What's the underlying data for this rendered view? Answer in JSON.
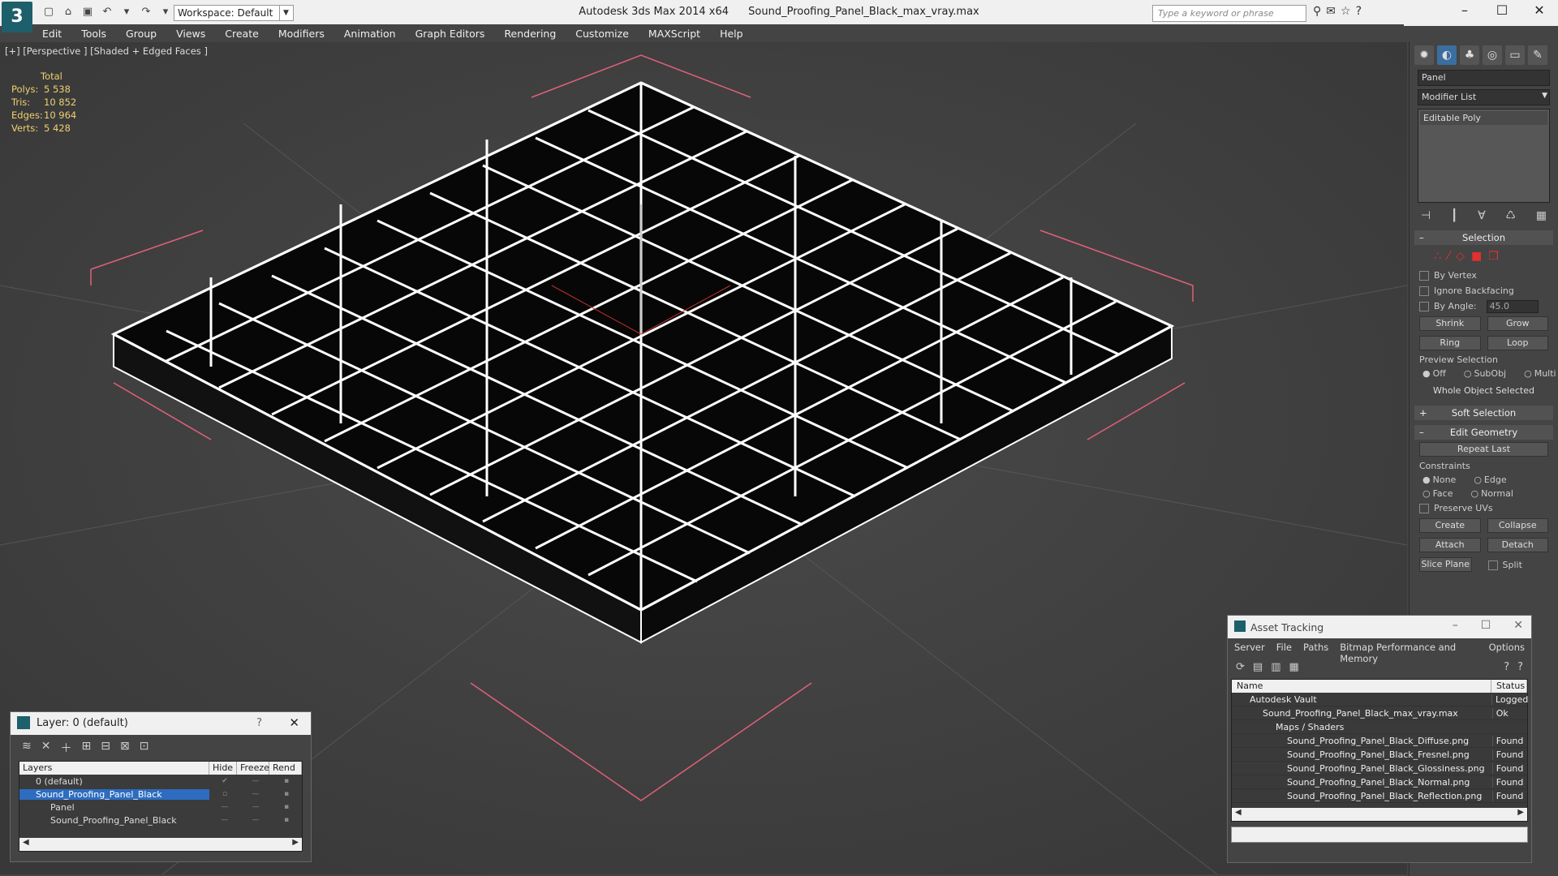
{
  "window": {
    "app_title": "Autodesk 3ds Max  2014 x64",
    "file_title": "Sound_Proofing_Panel_Black_max_vray.max",
    "workspace": "Workspace: Default",
    "search_placeholder": "Type a keyword or phrase"
  },
  "menu": [
    "Edit",
    "Tools",
    "Group",
    "Views",
    "Create",
    "Modifiers",
    "Animation",
    "Graph Editors",
    "Rendering",
    "Customize",
    "MAXScript",
    "Help"
  ],
  "viewport": {
    "label": "[+] [Perspective ] [Shaded + Edged Faces ]",
    "stats": {
      "header": "Total",
      "polys_label": "Polys:",
      "polys": "5 538",
      "tris_label": "Tris:",
      "tris": "10 852",
      "edges_label": "Edges:",
      "edges": "10 964",
      "verts_label": "Verts:",
      "verts": "5 428"
    }
  },
  "command_panel": {
    "object_name": "Panel",
    "modifier_list": "Modifier List",
    "stack_item": "Editable Poly",
    "selection": {
      "title": "Selection",
      "by_vertex": "By Vertex",
      "ignore_backfacing": "Ignore Backfacing",
      "by_angle": "By Angle:",
      "angle_value": "45.0",
      "shrink": "Shrink",
      "grow": "Grow",
      "ring": "Ring",
      "loop": "Loop",
      "preview_label": "Preview Selection",
      "preview_off": "Off",
      "preview_subobj": "SubObj",
      "preview_multi": "Multi",
      "status": "Whole Object Selected"
    },
    "soft_selection": "Soft Selection",
    "edit_geometry": {
      "title": "Edit Geometry",
      "repeat_last": "Repeat Last",
      "constraints": "Constraints",
      "none": "None",
      "edge": "Edge",
      "face": "Face",
      "normal": "Normal",
      "preserve_uvs": "Preserve UVs",
      "create": "Create",
      "collapse": "Collapse",
      "attach": "Attach",
      "detach": "Detach",
      "slice_plane": "Slice Plane",
      "split": "Split"
    }
  },
  "layer_window": {
    "title": "Layer: 0 (default)",
    "help": "?",
    "columns": [
      "Layers",
      "Hide",
      "Freeze",
      "Rend"
    ],
    "rows": [
      {
        "name": "0 (default)",
        "selected": false
      },
      {
        "name": "Sound_Proofing_Panel_Black",
        "selected": true
      },
      {
        "name": "Panel",
        "selected": false
      },
      {
        "name": "Sound_Proofing_Panel_Black",
        "selected": false
      }
    ]
  },
  "asset_tracking": {
    "title": "Asset Tracking",
    "menu": [
      "Server",
      "File",
      "Paths",
      "Bitmap Performance and Memory",
      "Options"
    ],
    "columns": [
      "Name",
      "Status"
    ],
    "rows": [
      {
        "name": "Autodesk Vault",
        "status": "Logged"
      },
      {
        "name": "Sound_Proofing_Panel_Black_max_vray.max",
        "status": "Ok"
      },
      {
        "name": "Maps / Shaders",
        "status": ""
      },
      {
        "name": "Sound_Proofing_Panel_Black_Diffuse.png",
        "status": "Found"
      },
      {
        "name": "Sound_Proofing_Panel_Black_Fresnel.png",
        "status": "Found"
      },
      {
        "name": "Sound_Proofing_Panel_Black_Glossiness.png",
        "status": "Found"
      },
      {
        "name": "Sound_Proofing_Panel_Black_Normal.png",
        "status": "Found"
      },
      {
        "name": "Sound_Proofing_Panel_Black_Reflection.png",
        "status": "Found"
      }
    ]
  }
}
